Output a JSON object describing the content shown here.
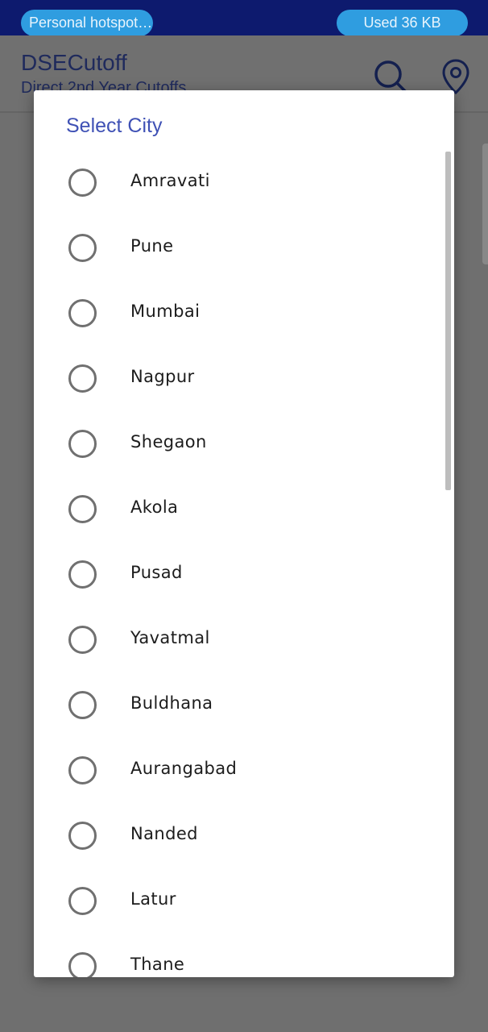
{
  "status_bar": {
    "hotspot_label": "Personal hotspot…",
    "data_usage_label": "Used  36 KB"
  },
  "app_bar": {
    "title": "DSECutoff",
    "subtitle": "Direct 2nd Year Cutoffs",
    "icons": [
      "search-icon",
      "location-pin-icon"
    ]
  },
  "dialog": {
    "title": "Select City",
    "options": [
      {
        "label": "Amravati",
        "selected": false
      },
      {
        "label": "Pune",
        "selected": false
      },
      {
        "label": "Mumbai",
        "selected": false
      },
      {
        "label": "Nagpur",
        "selected": false
      },
      {
        "label": "Shegaon",
        "selected": false
      },
      {
        "label": "Akola",
        "selected": false
      },
      {
        "label": "Pusad",
        "selected": false
      },
      {
        "label": "Yavatmal",
        "selected": false
      },
      {
        "label": "Buldhana",
        "selected": false
      },
      {
        "label": "Aurangabad",
        "selected": false
      },
      {
        "label": "Nanded",
        "selected": false
      },
      {
        "label": "Latur",
        "selected": false
      },
      {
        "label": "Thane",
        "selected": false
      }
    ]
  },
  "colors": {
    "status_bar_bg": "#0d1a6e",
    "pill_bg": "#2f9de0",
    "accent": "#3f51b5",
    "scrim": "#6f6f6f"
  }
}
